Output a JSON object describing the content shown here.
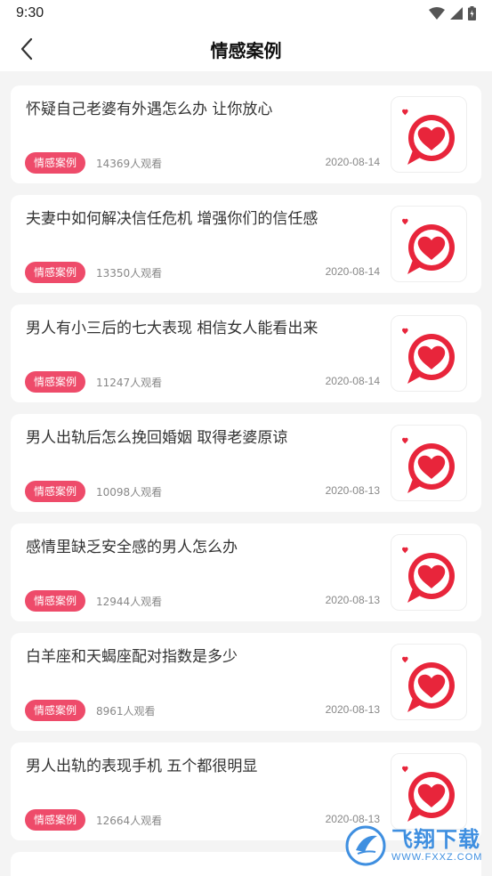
{
  "status_bar": {
    "time": "9:30"
  },
  "header": {
    "title": "情感案例"
  },
  "colors": {
    "accent": "#ee4b6a",
    "heart": "#e8253b",
    "watermark": "#3f8fe0"
  },
  "cases": [
    {
      "title": "怀疑自己老婆有外遇怎么办 让你放心",
      "tag": "情感案例",
      "views": "14369人观看",
      "date": "2020-08-14"
    },
    {
      "title": "夫妻中如何解决信任危机 增强你们的信任感",
      "tag": "情感案例",
      "views": "13350人观看",
      "date": "2020-08-14"
    },
    {
      "title": "男人有小三后的七大表现 相信女人能看出来",
      "tag": "情感案例",
      "views": "11247人观看",
      "date": "2020-08-14"
    },
    {
      "title": "男人出轨后怎么挽回婚姻 取得老婆原谅",
      "tag": "情感案例",
      "views": "10098人观看",
      "date": "2020-08-13"
    },
    {
      "title": "感情里缺乏安全感的男人怎么办",
      "tag": "情感案例",
      "views": "12944人观看",
      "date": "2020-08-13"
    },
    {
      "title": "白羊座和天蝎座配对指数是多少",
      "tag": "情感案例",
      "views": "8961人观看",
      "date": "2020-08-13"
    },
    {
      "title": "男人出轨的表现手机 五个都很明显",
      "tag": "情感案例",
      "views": "12664人观看",
      "date": "2020-08-13"
    }
  ],
  "watermark": {
    "main": "飞翔下载",
    "sub": "WWW.FXXZ.COM"
  }
}
